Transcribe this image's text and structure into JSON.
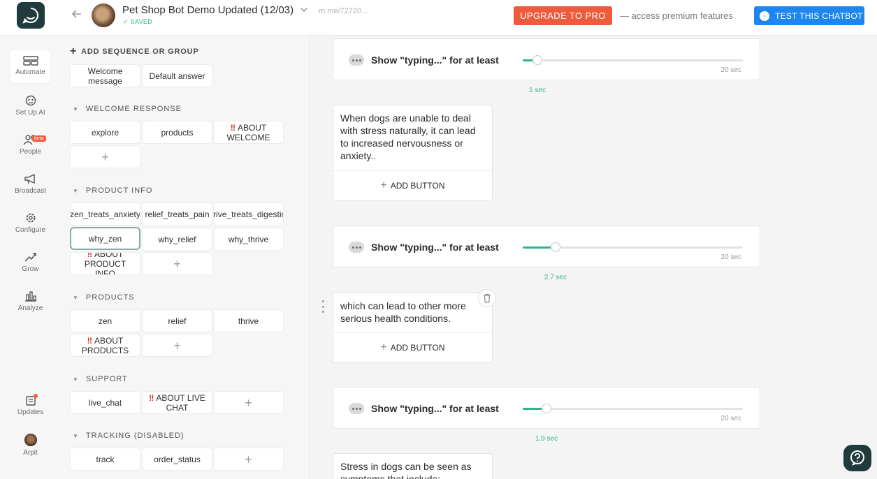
{
  "header": {
    "bot_title": "Pet Shop Bot Demo Updated (12/03)",
    "saved_status": "SAVED",
    "bot_url": "m.me/72720...",
    "upgrade_label": "UPGRADE TO PRO",
    "upgrade_note": "— access premium features",
    "test_label": "TEST THIS CHATBOT",
    "brand_color": "#1f3b3d",
    "upgrade_color": "#ef5a3c",
    "test_color": "#1d86f0"
  },
  "nav": {
    "items": [
      {
        "label": "Automate",
        "icon": "automate-icon",
        "active": true
      },
      {
        "label": "Set Up AI",
        "icon": "ai-brain-icon"
      },
      {
        "label": "People",
        "icon": "people-icon",
        "badge": "beta"
      },
      {
        "label": "Broadcast",
        "icon": "megaphone-icon"
      },
      {
        "label": "Configure",
        "icon": "gear-icon"
      },
      {
        "label": "Grow",
        "icon": "trend-up-icon"
      },
      {
        "label": "Analyze",
        "icon": "bar-chart-icon"
      }
    ],
    "updates_label": "Updates",
    "user_label": "Arpit"
  },
  "flows": {
    "add_sequence_label": "ADD SEQUENCE OR GROUP",
    "top_blocks": [
      "Welcome message",
      "Default answer"
    ],
    "sections": [
      {
        "title": "WELCOME RESPONSE",
        "blocks": [
          "explore",
          "products",
          "ABOUT WELCOME"
        ]
      },
      {
        "title": "PRODUCT INFO",
        "blocks": [
          "zen_treats_anxiety",
          "relief_treats_pain",
          "thrive_treats_digestion",
          "why_zen",
          "why_relief",
          "why_thrive",
          "ABOUT PRODUCT INFO"
        ]
      },
      {
        "title": "PRODUCTS",
        "blocks": [
          "zen",
          "relief",
          "thrive",
          "ABOUT PRODUCTS"
        ]
      },
      {
        "title": "SUPPORT",
        "blocks": [
          "live_chat",
          "ABOUT  LIVE CHAT"
        ]
      },
      {
        "title": "TRACKING (DISABLED)",
        "blocks": [
          "track",
          "order_status"
        ]
      }
    ],
    "selected_block": "why_zen"
  },
  "canvas": {
    "typing_label": "Show \"typing...\" for at least",
    "typing_max": "20 sec",
    "typing_delays": [
      {
        "value_label": "1 sec",
        "fraction": 0.067
      },
      {
        "value_label": "2.7 sec",
        "fraction": 0.149
      },
      {
        "value_label": "1.9 sec",
        "fraction": 0.108
      }
    ],
    "text_cards": [
      "When dogs are unable to deal with stress naturally, it can lead to increased nervousness or anxiety..",
      "which can lead to other more serious health conditions.",
      "Stress in dogs can be seen as symptoms that include:"
    ],
    "add_button_label": "ADD BUTTON"
  }
}
